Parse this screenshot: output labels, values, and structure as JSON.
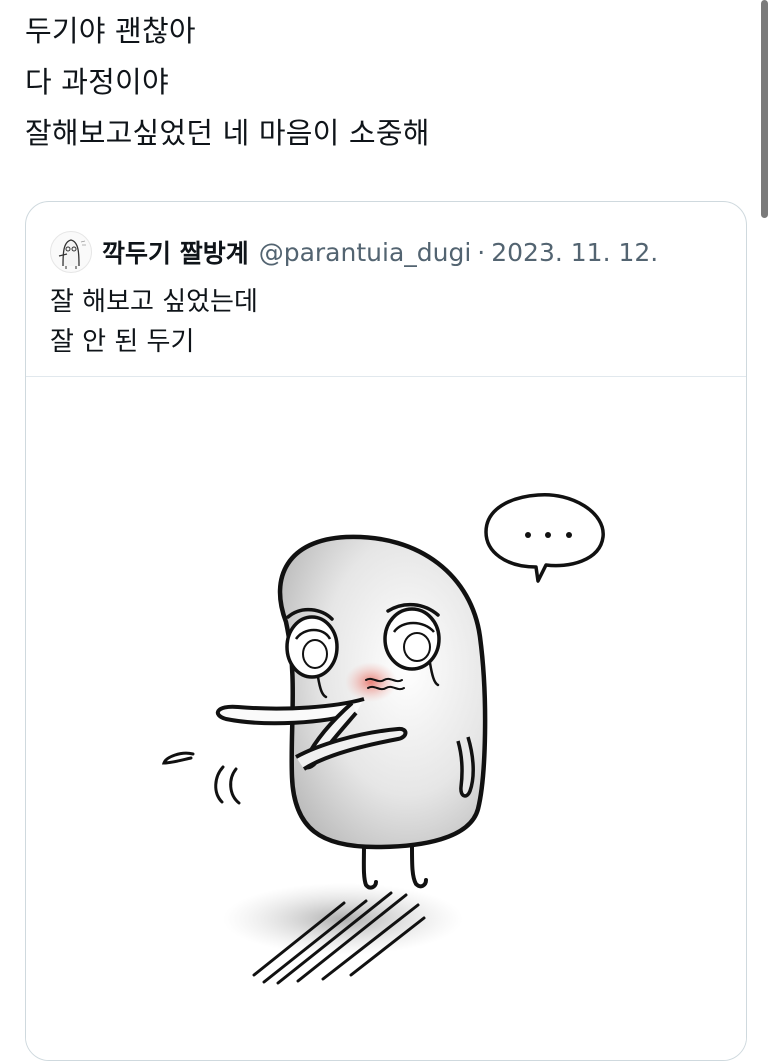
{
  "tweet": {
    "lines": [
      "두기야 괜찮아",
      "다 과정이야",
      "잘해보고싶었던 네 마음이 소중해"
    ]
  },
  "quoted_tweet": {
    "display_name": "깍두기 짤방계",
    "handle": "@parantuia_dugi",
    "separator": "·",
    "date": "2023. 11. 12.",
    "lines": [
      "잘 해보고 싶었는데",
      "잘 안 된 두기"
    ],
    "speech_bubble_text": "...",
    "avatar_icon": "ghost-avatar-icon",
    "media_icon": "crying-ghost-illustration"
  }
}
